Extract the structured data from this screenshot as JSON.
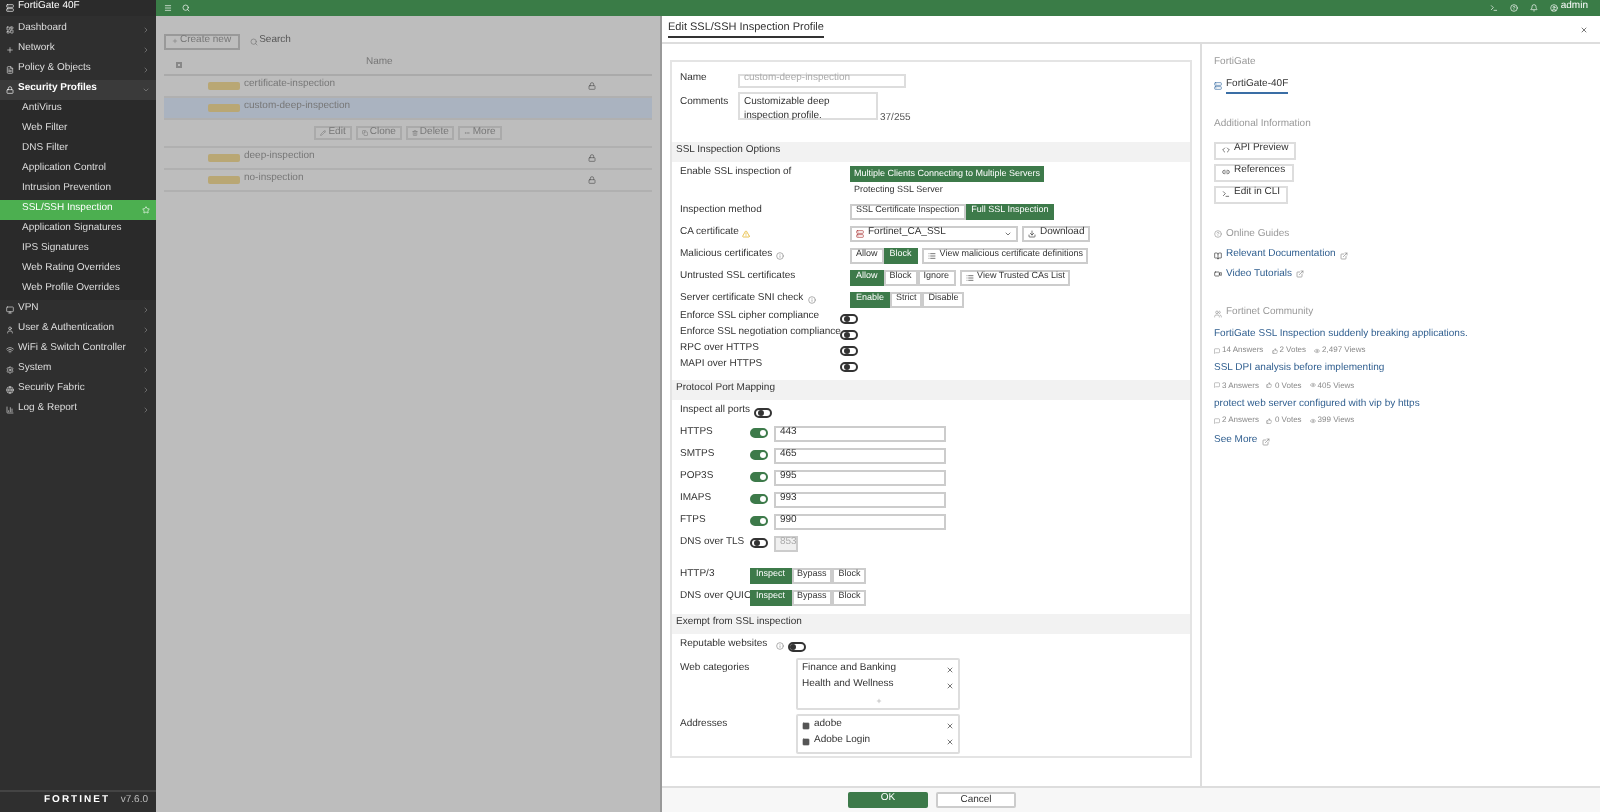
{
  "topbar": {
    "user": "admin"
  },
  "sidebar": {
    "device": "FortiGate 40F",
    "brand": "FORTINET",
    "version": "v7.6.0",
    "items": [
      {
        "label": "Dashboard",
        "expanded": false,
        "selected": false
      },
      {
        "label": "Network",
        "expanded": false,
        "selected": false
      },
      {
        "label": "Policy & Objects",
        "expanded": false,
        "selected": false
      },
      {
        "label": "Security Profiles",
        "expanded": true,
        "selected": false,
        "children": [
          {
            "label": "AntiVirus",
            "selected": false
          },
          {
            "label": "Web Filter",
            "selected": false
          },
          {
            "label": "DNS Filter",
            "selected": false
          },
          {
            "label": "Application Control",
            "selected": false
          },
          {
            "label": "Intrusion Prevention",
            "selected": false
          },
          {
            "label": "SSL/SSH Inspection",
            "selected": true
          },
          {
            "label": "Application Signatures",
            "selected": false
          },
          {
            "label": "IPS Signatures",
            "selected": false
          },
          {
            "label": "Web Rating Overrides",
            "selected": false
          },
          {
            "label": "Web Profile Overrides",
            "selected": false
          }
        ]
      },
      {
        "label": "VPN",
        "expanded": false,
        "selected": false
      },
      {
        "label": "User & Authentication",
        "expanded": false,
        "selected": false
      },
      {
        "label": "WiFi & Switch Controller",
        "expanded": false,
        "selected": false
      },
      {
        "label": "System",
        "expanded": false,
        "selected": false
      },
      {
        "label": "Security Fabric",
        "expanded": false,
        "selected": false
      },
      {
        "label": "Log & Report",
        "expanded": false,
        "selected": false
      }
    ]
  },
  "list": {
    "select_all": {
      "checked": false
    },
    "create": "Create new",
    "search_placeholder": "Search",
    "column": "Name",
    "rows": [
      {
        "name": "certificate-inspection",
        "locked": true,
        "selected": false
      },
      {
        "name": "custom-deep-inspection",
        "locked": false,
        "selected": true
      },
      {
        "name": "deep-inspection",
        "locked": true,
        "selected": false
      },
      {
        "name": "no-inspection",
        "locked": true,
        "selected": false
      }
    ],
    "actions": [
      {
        "label": "Edit"
      },
      {
        "label": "Clone"
      },
      {
        "label": "Delete"
      },
      {
        "label": "More"
      }
    ]
  },
  "dialog": {
    "title": "Edit SSL/SSH Inspection Profile",
    "name": {
      "label": "Name",
      "value": "custom-deep-inspection",
      "disabled": true
    },
    "comments": {
      "label": "Comments",
      "value": "Customizable deep inspection profile.",
      "counter": "37/255"
    },
    "sections": [
      {
        "title": "SSL Inspection Options",
        "rows": [
          {
            "kind": "stacked_choice",
            "label": "Enable SSL inspection of",
            "options": [
              {
                "label": "Multiple Clients Connecting to Multiple Servers",
                "selected": true
              },
              {
                "label": "Protecting SSL Server",
                "selected": false
              }
            ]
          },
          {
            "kind": "choice",
            "label": "Inspection method",
            "options": [
              {
                "label": "SSL Certificate Inspection",
                "selected": false
              },
              {
                "label": "Full SSL Inspection",
                "selected": true
              }
            ]
          },
          {
            "kind": "select",
            "label": "CA certificate",
            "warning": true,
            "value": "Fortinet_CA_SSL",
            "action": "Download"
          },
          {
            "kind": "choice",
            "label": "Malicious certificates",
            "info": true,
            "options": [
              {
                "label": "Allow",
                "selected": false
              },
              {
                "label": "Block",
                "selected": true
              }
            ],
            "action": "View malicious certificate definitions"
          },
          {
            "kind": "choice",
            "label": "Untrusted SSL certificates",
            "options": [
              {
                "label": "Allow",
                "selected": true
              },
              {
                "label": "Block",
                "selected": false
              },
              {
                "label": "Ignore",
                "selected": false
              }
            ],
            "action": "View Trusted CAs List"
          },
          {
            "kind": "choice",
            "label": "Server certificate SNI check",
            "info": true,
            "options": [
              {
                "label": "Enable",
                "selected": true
              },
              {
                "label": "Strict",
                "selected": false
              },
              {
                "label": "Disable",
                "selected": false
              }
            ]
          },
          {
            "kind": "toggle",
            "label": "Enforce SSL cipher compliance",
            "on": false
          },
          {
            "kind": "toggle",
            "label": "Enforce SSL negotiation compliance",
            "on": false
          },
          {
            "kind": "toggle",
            "label": "RPC over HTTPS",
            "on": false
          },
          {
            "kind": "toggle",
            "label": "MAPI over HTTPS",
            "on": false
          }
        ]
      },
      {
        "title": "Protocol Port Mapping",
        "rows": [
          {
            "kind": "inline_toggle",
            "label": "Inspect all ports",
            "on": false
          },
          {
            "kind": "port",
            "label": "HTTPS",
            "on": true,
            "value": "443"
          },
          {
            "kind": "port",
            "label": "SMTPS",
            "on": true,
            "value": "465"
          },
          {
            "kind": "port",
            "label": "POP3S",
            "on": true,
            "value": "995"
          },
          {
            "kind": "port",
            "label": "IMAPS",
            "on": true,
            "value": "993"
          },
          {
            "kind": "port",
            "label": "FTPS",
            "on": true,
            "value": "990"
          },
          {
            "kind": "port",
            "label": "DNS over TLS",
            "on": false,
            "value": "853"
          },
          {
            "kind": "choice",
            "label": "HTTP/3",
            "options": [
              {
                "label": "Inspect",
                "selected": true
              },
              {
                "label": "Bypass",
                "selected": false
              },
              {
                "label": "Block",
                "selected": false
              }
            ]
          },
          {
            "kind": "choice",
            "label": "DNS over QUIC",
            "options": [
              {
                "label": "Inspect",
                "selected": true
              },
              {
                "label": "Bypass",
                "selected": false
              },
              {
                "label": "Block",
                "selected": false
              }
            ]
          }
        ]
      },
      {
        "title": "Exempt from SSL inspection",
        "rows": [
          {
            "kind": "inline_toggle",
            "label": "Reputable websites",
            "info": true,
            "on": false
          },
          {
            "kind": "list",
            "label": "Web categories",
            "add": true,
            "items": [
              {
                "label": "Finance and Banking",
                "kind": "category"
              },
              {
                "label": "Health and Wellness",
                "kind": "category"
              }
            ]
          },
          {
            "kind": "list",
            "label": "Addresses",
            "add": false,
            "items": [
              {
                "label": "adobe",
                "kind": "address"
              },
              {
                "label": "Adobe Login",
                "kind": "address"
              }
            ]
          }
        ]
      }
    ],
    "buttons": [
      {
        "label": "OK",
        "primary": true
      },
      {
        "label": "Cancel",
        "primary": false
      }
    ]
  },
  "side": {
    "device_heading": "FortiGate",
    "device": "FortiGate-40F",
    "info_heading": "Additional Information",
    "info_buttons": [
      {
        "label": "API Preview"
      },
      {
        "label": "References"
      },
      {
        "label": "Edit in CLI"
      }
    ],
    "guides_heading": "Online Guides",
    "guides": [
      {
        "label": "Relevant Documentation"
      },
      {
        "label": "Video Tutorials"
      }
    ],
    "community_heading": "Fortinet Community",
    "posts": [
      {
        "title": "FortiGate SSL Inspection suddenly breaking applications.",
        "answers": "14 Answers",
        "votes": "2 Votes",
        "views": "2,497 Views"
      },
      {
        "title": "SSL DPI analysis before implementing",
        "answers": "3 Answers",
        "votes": "0 Votes",
        "views": "405 Views"
      },
      {
        "title": "protect web server configured with vip by https",
        "answers": "2 Answers",
        "votes": "0 Votes",
        "views": "399 Views"
      }
    ],
    "see_more": "See More"
  }
}
